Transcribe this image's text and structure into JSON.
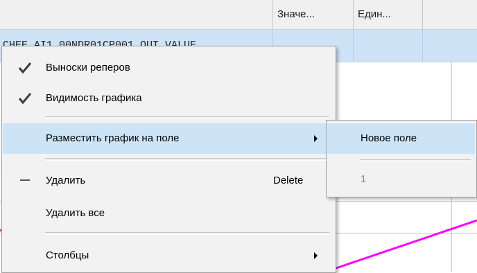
{
  "table": {
    "columns": [
      "Значе...",
      "Един..."
    ],
    "row_tag": "CHEE.AI1.00NDR01CP001.OUT_VALUE"
  },
  "colors": {
    "selection": "#cde4f7",
    "trend_line": "#ff00ff",
    "menu_background": "#f2f2f2"
  },
  "context_menu": {
    "items": [
      {
        "label": "Выноски реперов",
        "icon": "checkmark-icon",
        "checked": true
      },
      {
        "label": "Видимость графика",
        "icon": "checkmark-icon",
        "checked": true
      },
      {
        "label": "Разместить график на поле",
        "has_submenu": true,
        "highlighted": true
      },
      {
        "label": "Удалить",
        "icon": "dash-icon",
        "shortcut": "Delete"
      },
      {
        "label": "Удалить все"
      },
      {
        "label": "Столбцы",
        "has_submenu": true
      }
    ]
  },
  "submenu": {
    "items": [
      {
        "label": "Новое поле",
        "highlighted": true
      },
      {
        "label": "1",
        "disabled": true
      }
    ]
  }
}
